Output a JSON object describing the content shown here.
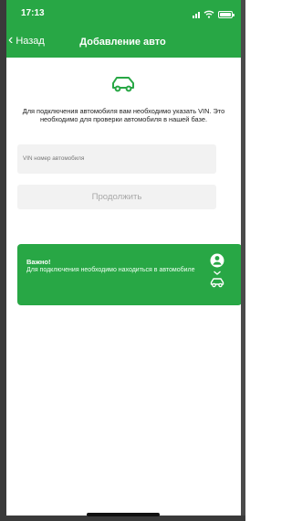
{
  "status_bar": {
    "time": "17:13"
  },
  "nav": {
    "back_label": "Назад",
    "title": "Добавление авто"
  },
  "intro": {
    "text": "Для подключения автомобиля вам необходимо указать VIN. Это необходимо для проверки автомобиля в нашей базе."
  },
  "vin_input": {
    "placeholder": "VIN номер автомобиля"
  },
  "continue_button": {
    "label": "Продолжить"
  },
  "notice": {
    "title": "Важно!",
    "text": "Для подключения необходимо находиться в автомобиле"
  },
  "icons": {
    "car": "car-icon",
    "person": "person-icon",
    "chevron": "chevron-down-icon",
    "signal": "signal-icon",
    "wifi": "wifi-icon",
    "battery": "battery-icon"
  },
  "colors": {
    "accent": "#28a745",
    "field_bg": "#f2f2f2",
    "disabled_text": "#a8a8a8"
  }
}
